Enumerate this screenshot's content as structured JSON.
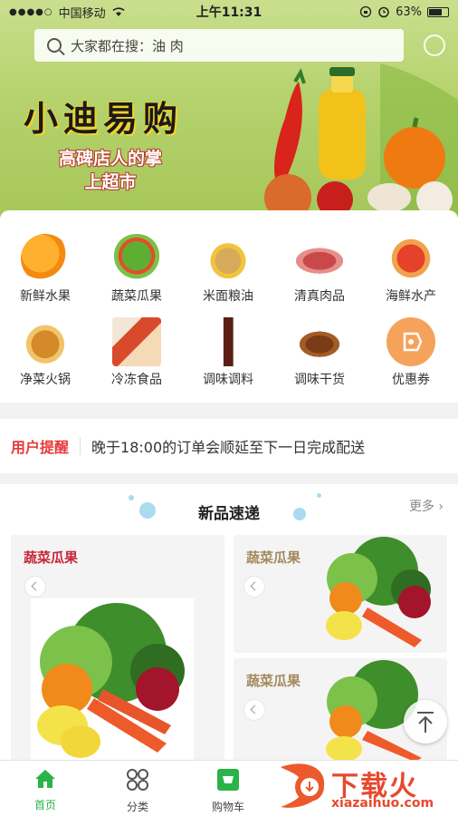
{
  "status_bar": {
    "carrier": "中国移动",
    "time": "上午11:31",
    "battery": "63%",
    "battery_level": 0.63
  },
  "search": {
    "placeholder": "大家都在搜：油 肉"
  },
  "banner": {
    "brand": "小迪易购",
    "slogan": "高碑店人的掌上超市"
  },
  "categories": [
    {
      "label": "新鲜水果",
      "icon": "fruit-icon"
    },
    {
      "label": "蔬菜瓜果",
      "icon": "vegetable-icon"
    },
    {
      "label": "米面粮油",
      "icon": "grain-oil-icon"
    },
    {
      "label": "清真肉品",
      "icon": "meat-icon"
    },
    {
      "label": "海鲜水产",
      "icon": "seafood-icon"
    },
    {
      "label": "净菜火锅",
      "icon": "hotpot-icon"
    },
    {
      "label": "冷冻食品",
      "icon": "frozen-food-icon"
    },
    {
      "label": "调味调料",
      "icon": "seasoning-icon"
    },
    {
      "label": "调味干货",
      "icon": "dried-goods-icon"
    },
    {
      "label": "优惠券",
      "icon": "coupon-icon"
    }
  ],
  "notice": {
    "tag": "用户提醒",
    "text": "晚于18:00的订单会顺延至下一日完成配送"
  },
  "new_arrivals": {
    "title": "新品速递",
    "more": "更多 ›",
    "cards": [
      {
        "title": "蔬菜瓜果",
        "title_color": "#c8283a"
      },
      {
        "title": "蔬菜瓜果",
        "title_color": "#a38a5e"
      },
      {
        "title": "蔬菜瓜果",
        "title_color": "#a38a5e"
      }
    ]
  },
  "tabbar": [
    {
      "label": "首页",
      "icon": "home-icon",
      "active": true
    },
    {
      "label": "分类",
      "icon": "category-icon",
      "active": false
    },
    {
      "label": "购物车",
      "icon": "cart-icon",
      "active": false
    }
  ],
  "watermark": {
    "text": "下载火",
    "url": "xiazaihuo.com"
  },
  "colors": {
    "accent": "#2ab34a",
    "notice_red": "#e83a3a",
    "banner_green": "#b5d26d"
  }
}
